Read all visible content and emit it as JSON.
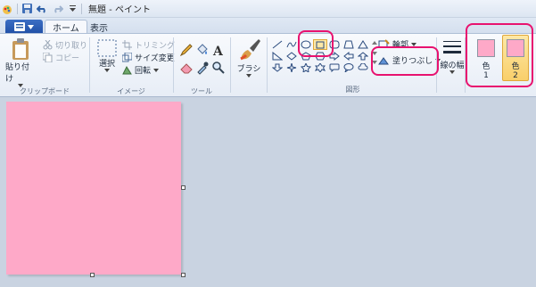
{
  "title_bar": {
    "title": "無題 - ペイント"
  },
  "tabs": {
    "home": "ホーム",
    "view": "表示"
  },
  "clipboard": {
    "paste": "貼り付け",
    "cut": "切り取り",
    "copy": "コピー",
    "group_label": "クリップボード"
  },
  "image": {
    "select": "選択",
    "crop": "トリミング",
    "resize": "サイズ変更",
    "rotate": "回転",
    "group_label": "イメージ"
  },
  "tools": {
    "group_label": "ツール"
  },
  "brushes": {
    "label": "ブラシ"
  },
  "shapes": {
    "outline": "輪郭",
    "fill": "塗りつぶし",
    "group_label": "図形"
  },
  "size": {
    "label": "線の幅"
  },
  "colors": {
    "color1_label": "色",
    "color1_num": "1",
    "color2_label": "色",
    "color2_num": "2",
    "color1_value": "#fea9c8",
    "color2_value": "#fea9c8"
  },
  "annotation_color": "#e8126f",
  "canvas_color": "#fea9c8"
}
